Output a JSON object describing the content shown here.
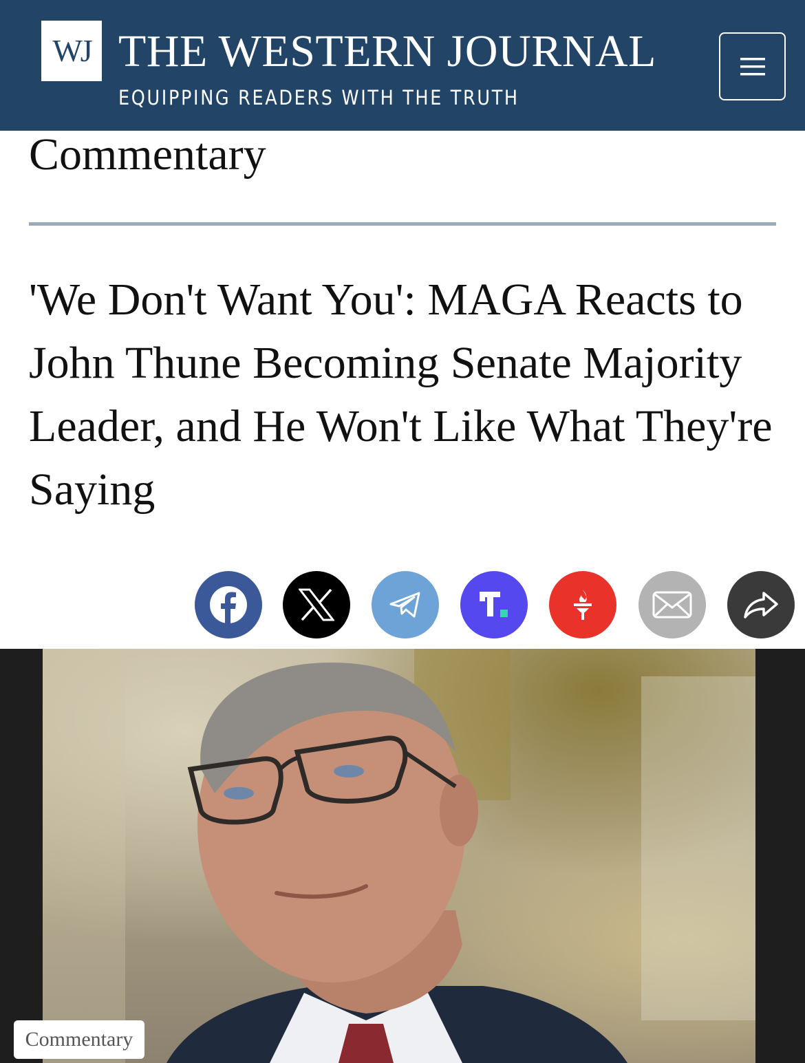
{
  "header": {
    "logo_text": "WJ",
    "brand_name": "THE WESTERN JOURNAL",
    "tagline": "EQUIPPING READERS WITH THE TRUTH",
    "menu_icon": "hamburger-menu-icon",
    "background_color": "#224466"
  },
  "section": {
    "label": "Commentary"
  },
  "article": {
    "headline": "'We Don't Want You': MAGA Reacts to John Thune Becoming Senate Majority Leader, and He Won't Like What They're Saying",
    "image_badge": "Commentary"
  },
  "share_buttons": [
    {
      "name": "facebook",
      "icon": "facebook-icon",
      "color": "#3b5998"
    },
    {
      "name": "x",
      "icon": "x-icon",
      "color": "#000000"
    },
    {
      "name": "telegram",
      "icon": "telegram-icon",
      "color": "#6ea3d8"
    },
    {
      "name": "truth-social",
      "icon": "truth-social-icon",
      "color": "#5448ee"
    },
    {
      "name": "gettr",
      "icon": "gettr-icon",
      "color": "#e8322a"
    },
    {
      "name": "email",
      "icon": "email-icon",
      "color": "#b3b3b3"
    },
    {
      "name": "share",
      "icon": "share-icon",
      "color": "#3a3a3a"
    }
  ]
}
